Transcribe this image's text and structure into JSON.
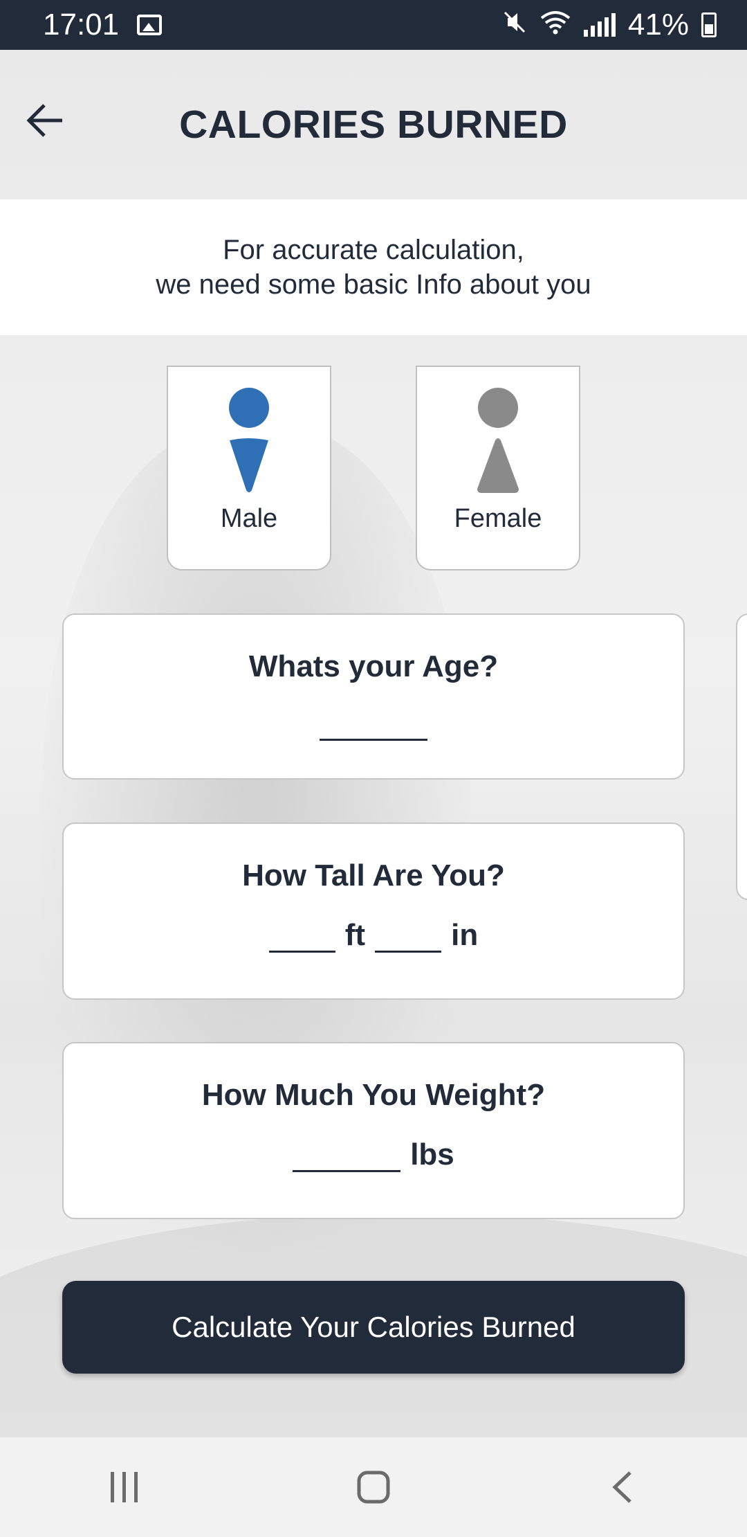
{
  "status_bar": {
    "time": "17:01",
    "battery": "41%",
    "icons": [
      "image-icon",
      "mute-icon",
      "wifi-icon",
      "signal-icon",
      "battery-charging-icon"
    ]
  },
  "header": {
    "title": "CALORIES BURNED",
    "back_icon": "arrow-left-icon"
  },
  "intro": {
    "line1": "For accurate calculation,",
    "line2": "we need some basic Info about you"
  },
  "gender": {
    "male_label": "Male",
    "female_label": "Female",
    "selected": "Male",
    "selected_color": "#2f6fb5",
    "unselected_color": "#8a8a8a"
  },
  "age": {
    "question": "Whats your Age?",
    "value": ""
  },
  "height": {
    "question": "How Tall Are You?",
    "feet_value": "",
    "feet_unit": "ft",
    "inches_value": "",
    "inches_unit": "in"
  },
  "weight": {
    "question": "How Much You Weight?",
    "value": "",
    "unit": "lbs"
  },
  "calculate_button": {
    "label": "Calculate Your Calories Burned"
  },
  "nav_bar": {
    "icons": [
      "recent-apps-icon",
      "home-icon",
      "back-icon"
    ]
  },
  "colors": {
    "primary_dark": "#222b3a",
    "accent_blue": "#2f6fb5"
  }
}
